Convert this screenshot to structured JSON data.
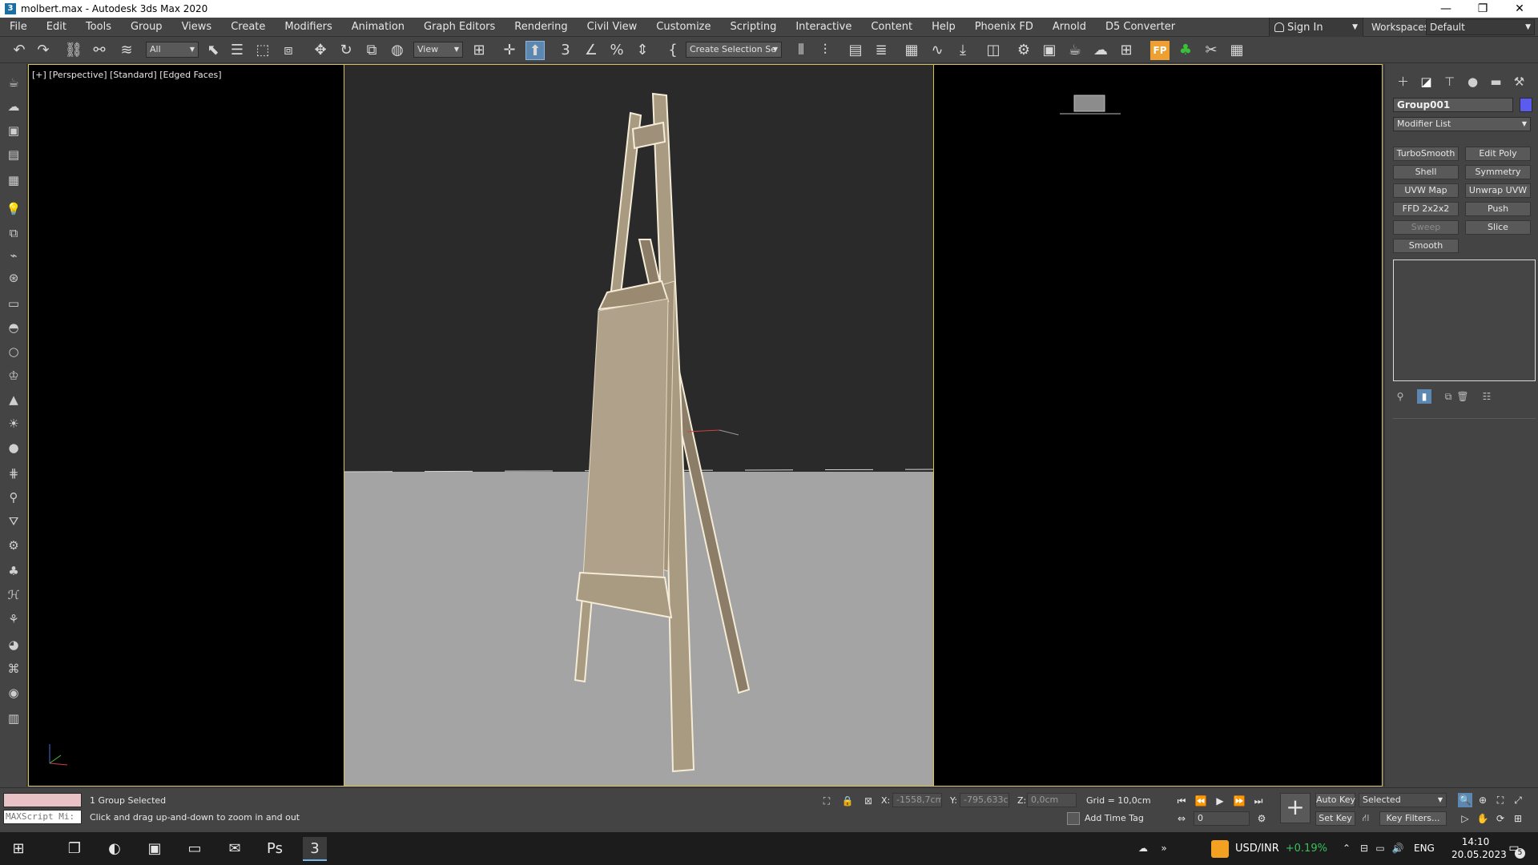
{
  "window": {
    "title": "molbert.max - Autodesk 3ds Max 2020",
    "minimize": "—",
    "restore": "❐",
    "close": "✕"
  },
  "menu": {
    "items": [
      "File",
      "Edit",
      "Tools",
      "Group",
      "Views",
      "Create",
      "Modifiers",
      "Animation",
      "Graph Editors",
      "Rendering",
      "Civil View",
      "Customize",
      "Scripting",
      "Interactive",
      "Content",
      "Help",
      "Phoenix FD",
      "Arnold",
      "D5 Converter"
    ],
    "sign_in": "Sign In",
    "workspaces_label": "Workspaces:",
    "workspace_value": "Default"
  },
  "toolbar": {
    "selection_filter": "All",
    "ref_coord": "View",
    "named_selection": "Create Selection Se"
  },
  "viewport": {
    "label": "[+] [Perspective] [Standard] [Edged Faces]"
  },
  "command_panel": {
    "object_name": "Group001",
    "object_color": "#5a5cf0",
    "modifier_list": "Modifier List",
    "modifier_buttons": [
      "TurboSmooth",
      "Edit Poly",
      "Shell",
      "Symmetry",
      "UVW Map",
      "Unwrap UVW",
      "FFD 2x2x2",
      "Push",
      "Sweep",
      "Slice",
      "Smooth"
    ],
    "disabled_buttons": [
      "Sweep"
    ]
  },
  "status": {
    "selection": "1 Group Selected",
    "prompt": "Click and drag up-and-down to zoom in and out",
    "maxscript_placeholder": "MAXScript Mi:",
    "x_label": "X:",
    "x_value": "-1558,7cm",
    "y_label": "Y:",
    "y_value": "-795,633cm",
    "z_label": "Z:",
    "z_value": "0,0cm",
    "grid": "Grid = 10,0cm",
    "add_time_tag": "Add Time Tag",
    "frame": "0",
    "auto_key": "Auto Key",
    "set_key": "Set Key",
    "key_mode": "Selected",
    "key_filters": "Key Filters..."
  },
  "taskbar": {
    "currency_pair": "USD/INR",
    "currency_change": "+0.19%",
    "language": "ENG",
    "time": "14:10",
    "date": "20.05.2023",
    "notifications": "5"
  },
  "colors": {
    "accent_blue": "#5b87b0",
    "viewport_border": "#d6c05a",
    "easel_wood": "#a99a82",
    "positive": "#37c15a"
  }
}
